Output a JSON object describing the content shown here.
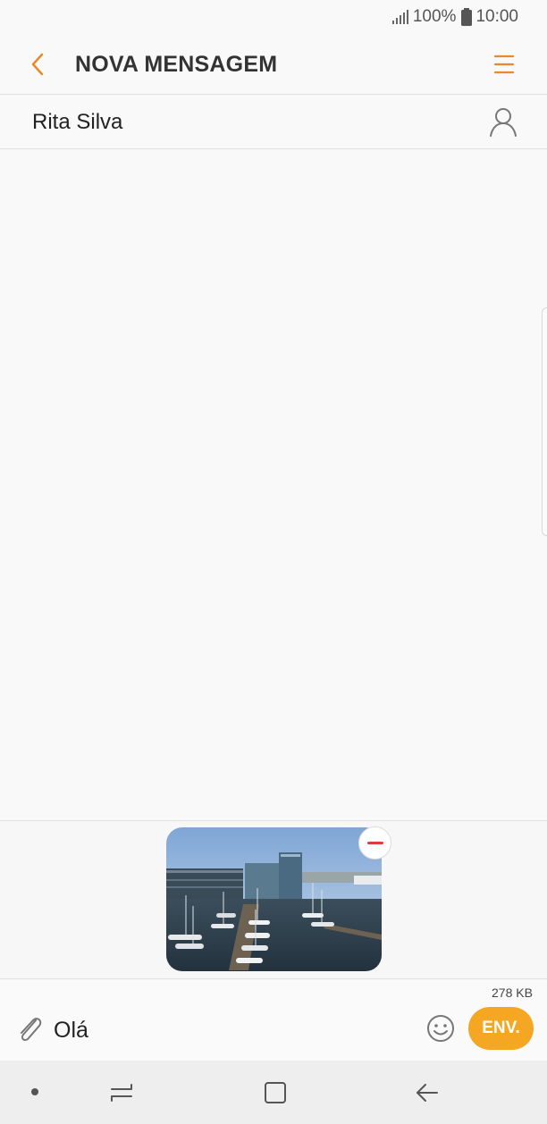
{
  "status": {
    "battery": "100%",
    "time": "10:00",
    "icons": [
      "signal-icon",
      "battery-icon"
    ]
  },
  "header": {
    "title": "NOVA MENSAGEM",
    "back_icon": "chevron-left-icon",
    "menu_icon": "menu-icon"
  },
  "recipient": {
    "name": "Rita Silva",
    "contact_icon": "contact-icon"
  },
  "attachment": {
    "icon": "photo-thumbnail",
    "remove_icon": "minus-circle-icon"
  },
  "composer": {
    "size": "278 KB",
    "text": "Olá",
    "send_label": "ENV.",
    "attach_icon": "paperclip-icon",
    "emoji_icon": "smiley-icon"
  },
  "navbar": {
    "icons": [
      "dot-icon",
      "recents-icon",
      "home-icon",
      "back-arrow-icon"
    ]
  },
  "colors": {
    "accent": "#f5a623",
    "accent_text": "#e8892e",
    "remove": "#e53935"
  }
}
